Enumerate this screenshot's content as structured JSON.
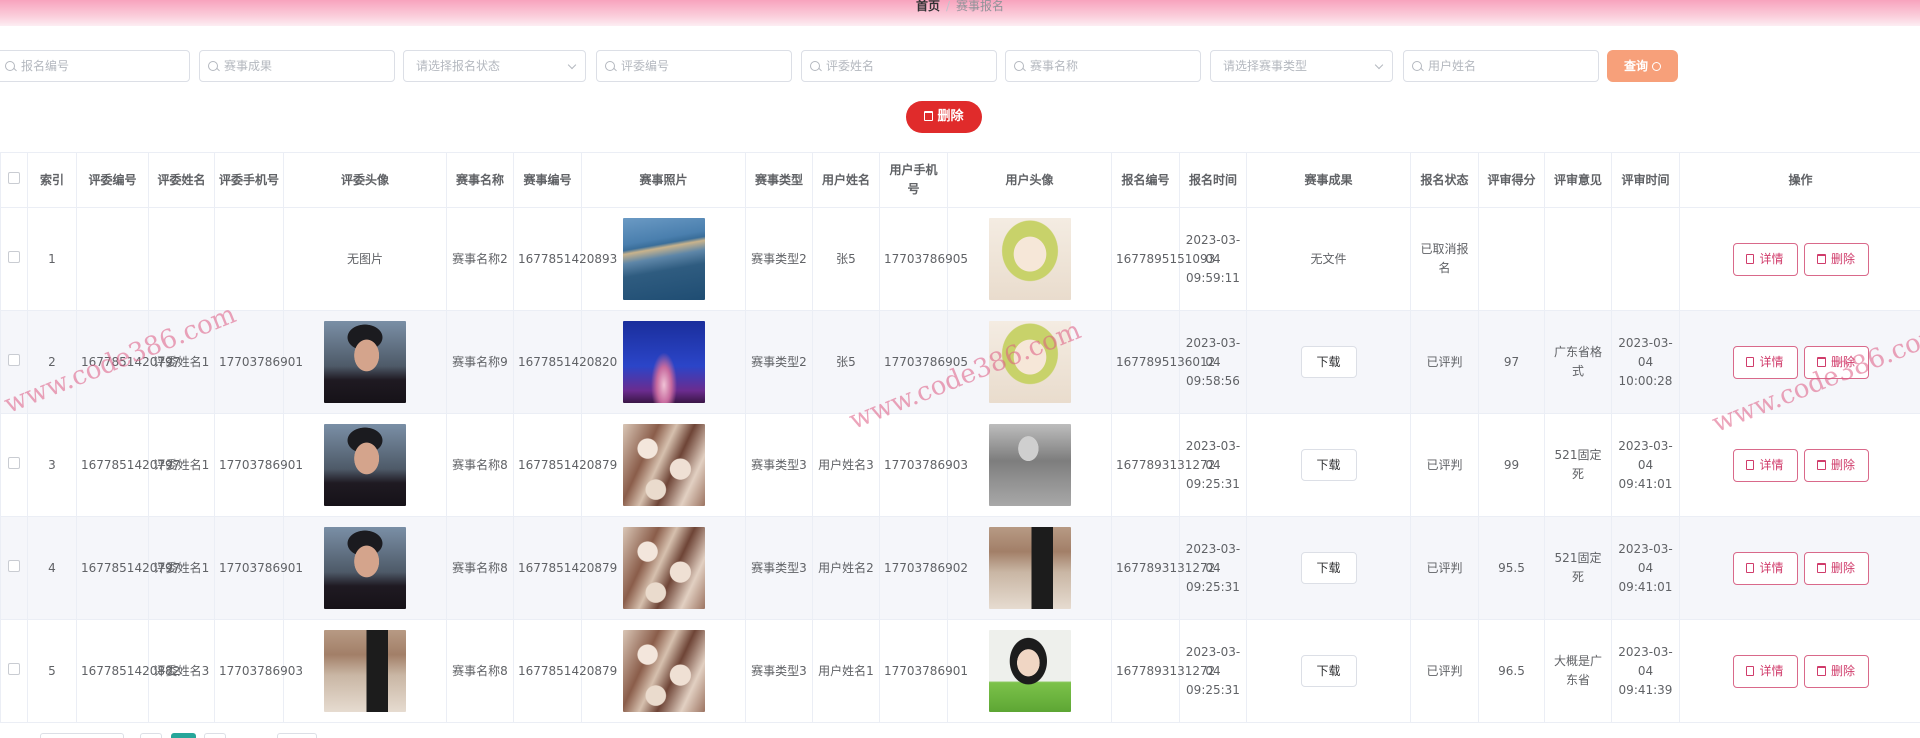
{
  "breadcrumb": {
    "home": "首页",
    "separator": "/",
    "current": "赛事报名"
  },
  "filters": {
    "baoming_bianhao": "报名编号",
    "saishi_chengguo": "赛事成果",
    "status_select": "请选择报名状态",
    "pingwei_bianhao": "评委编号",
    "pingwei_xingming": "评委姓名",
    "saishi_mingcheng": "赛事名称",
    "type_select": "请选择赛事类型",
    "yonghu_xingming": "用户姓名",
    "query_label": "查询"
  },
  "toolbar": {
    "delete_label": "删除"
  },
  "columns": [
    "索引",
    "评委编号",
    "评委姓名",
    "评委手机号",
    "评委头像",
    "赛事名称",
    "赛事编号",
    "赛事照片",
    "赛事类型",
    "用户姓名",
    "用户手机号",
    "用户头像",
    "报名编号",
    "报名时间",
    "赛事成果",
    "报名状态",
    "评审得分",
    "评审意见",
    "评审时间",
    "操作"
  ],
  "ui": {
    "no_image": "无图片",
    "no_file": "无文件",
    "download": "下载",
    "detail": "详情",
    "delete": "删除"
  },
  "rows": [
    {
      "index": "1",
      "judge_no": "",
      "judge_name": "",
      "judge_phone": "",
      "judge_avatar": "none",
      "event_name": "赛事名称2",
      "event_no": "1677851420893",
      "event_photo": "coast-aerial",
      "event_type": "赛事类型2",
      "user_name": "张5",
      "user_phone": "17703786905",
      "user_avatar": "anime-girl",
      "reg_no": "1677895151093",
      "reg_time": "2023-03-04 09:59:11",
      "result": "none",
      "status": "已取消报名",
      "score": "",
      "opinion": "",
      "review_time": ""
    },
    {
      "index": "2",
      "judge_no": "1677851420797",
      "judge_name": "评委姓名1",
      "judge_phone": "17703786901",
      "judge_avatar": "man-portrait",
      "event_name": "赛事名称9",
      "event_no": "1677851420820",
      "event_photo": "eiffel-night",
      "event_type": "赛事类型2",
      "user_name": "张5",
      "user_phone": "17703786905",
      "user_avatar": "anime-girl",
      "reg_no": "1677895136012",
      "reg_time": "2023-03-04 09:58:56",
      "result": "file",
      "status": "已评判",
      "score": "97",
      "opinion": "广东省格式",
      "review_time": "2023-03-04 10:00:28"
    },
    {
      "index": "3",
      "judge_no": "1677851420797",
      "judge_name": "评委姓名1",
      "judge_phone": "17703786901",
      "judge_avatar": "man-portrait",
      "event_name": "赛事名称8",
      "event_no": "1677851420879",
      "event_photo": "blossom-branches",
      "event_type": "赛事类型3",
      "user_name": "用户姓名3",
      "user_phone": "17703786903",
      "user_avatar": "bw-man",
      "reg_no": "1677893131272",
      "reg_time": "2023-03-04 09:25:31",
      "result": "file",
      "status": "已评判",
      "score": "99",
      "opinion": "521固定死",
      "review_time": "2023-03-04 09:41:01"
    },
    {
      "index": "4",
      "judge_no": "1677851420797",
      "judge_name": "评委姓名1",
      "judge_phone": "17703786901",
      "judge_avatar": "man-portrait",
      "event_name": "赛事名称8",
      "event_no": "1677851420879",
      "event_photo": "blossom-branches",
      "event_type": "赛事类型3",
      "user_name": "用户姓名2",
      "user_phone": "17703786902",
      "user_avatar": "gallery-man",
      "reg_no": "1677893131272",
      "reg_time": "2023-03-04 09:25:31",
      "result": "file",
      "status": "已评判",
      "score": "95.5",
      "opinion": "521固定死",
      "review_time": "2023-03-04 09:41:01"
    },
    {
      "index": "5",
      "judge_no": "1677851420882",
      "judge_name": "评委姓名3",
      "judge_phone": "17703786903",
      "judge_avatar": "gallery-man",
      "event_name": "赛事名称8",
      "event_no": "1677851420879",
      "event_photo": "blossom-branches",
      "event_type": "赛事类型3",
      "user_name": "用户姓名1",
      "user_phone": "17703786901",
      "user_avatar": "girl-green",
      "reg_no": "1677893131272",
      "reg_time": "2023-03-04 09:25:31",
      "result": "file",
      "status": "已评判",
      "score": "96.5",
      "opinion": "大概是广东省",
      "review_time": "2023-03-04 09:41:39"
    }
  ],
  "watermark": "www.code386.com",
  "colors": {
    "accent": "#d03c6b",
    "query": "#f7a07a",
    "danger": "#e02b2b",
    "header_pink": "#f8a3bd"
  }
}
